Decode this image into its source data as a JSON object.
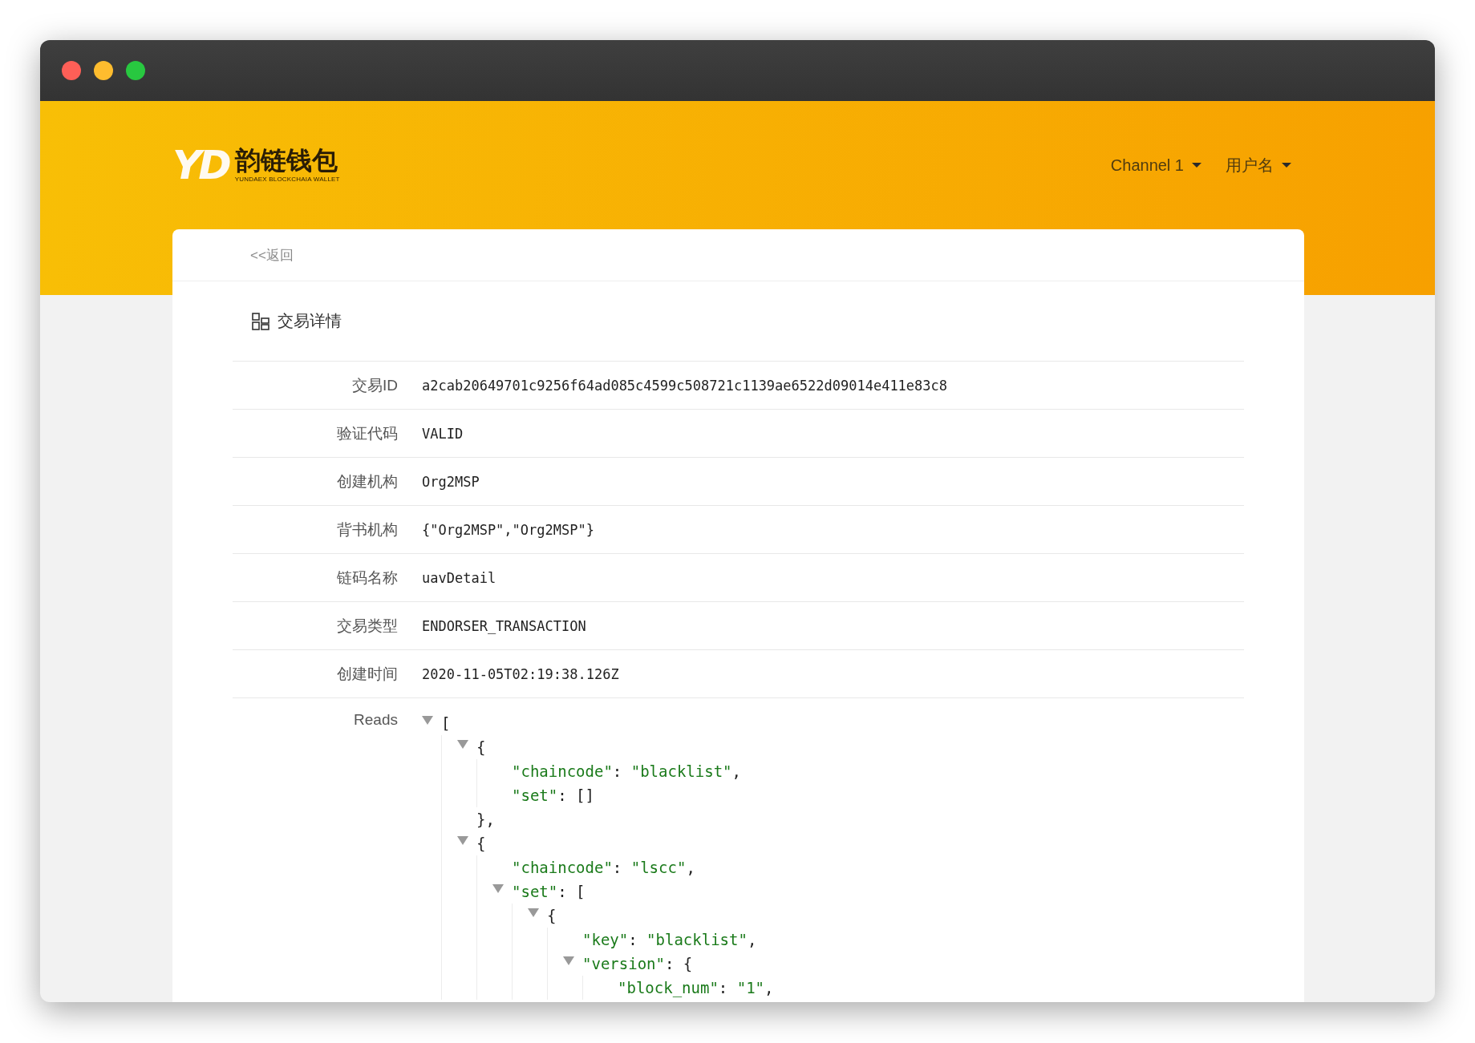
{
  "header": {
    "logo_mark": "YD",
    "logo_name": "韵链钱包",
    "logo_tagline": "YUNDAEX BLOCKCHAIA WALLET",
    "nav": [
      {
        "label": "Channel 1"
      },
      {
        "label": "用户名"
      }
    ]
  },
  "back_link": "<<返回",
  "section_title": "交易详情",
  "fields": [
    {
      "label": "交易ID",
      "value": "a2cab20649701c9256f64ad085c4599c508721c1139ae6522d09014e411e83c8"
    },
    {
      "label": "验证代码",
      "value": "VALID"
    },
    {
      "label": "创建机构",
      "value": "Org2MSP"
    },
    {
      "label": "背书机构",
      "value": "{\"Org2MSP\",\"Org2MSP\"}"
    },
    {
      "label": "链码名称",
      "value": "uavDetail"
    },
    {
      "label": "交易类型",
      "value": "ENDORSER_TRANSACTION"
    },
    {
      "label": "创建时间",
      "value": "2020-11-05T02:19:38.126Z"
    }
  ],
  "reads": {
    "label": "Reads",
    "tree": {
      "open": "[",
      "expanded": true,
      "children": [
        {
          "open": "{",
          "expanded": true,
          "close": "},",
          "children": [
            {
              "key": "\"chaincode\"",
              "sep": ":",
              "value": "\"blacklist\"",
              "tail": ","
            },
            {
              "key": "\"set\"",
              "sep": ":",
              "literal": "[]"
            }
          ]
        },
        {
          "open": "{",
          "expanded": true,
          "children": [
            {
              "key": "\"chaincode\"",
              "sep": ":",
              "value": "\"lscc\"",
              "tail": ","
            },
            {
              "key": "\"set\"",
              "sep": ":",
              "open": "[",
              "expanded": true,
              "children": [
                {
                  "open": "{",
                  "expanded": true,
                  "children": [
                    {
                      "key": "\"key\"",
                      "sep": ":",
                      "value": "\"blacklist\"",
                      "tail": ","
                    },
                    {
                      "key": "\"version\"",
                      "sep": ":",
                      "open": "{",
                      "expanded": true,
                      "children": [
                        {
                          "key": "\"block_num\"",
                          "sep": ":",
                          "value": "\"1\"",
                          "tail": ","
                        }
                      ]
                    }
                  ]
                }
              ]
            }
          ]
        }
      ]
    }
  }
}
